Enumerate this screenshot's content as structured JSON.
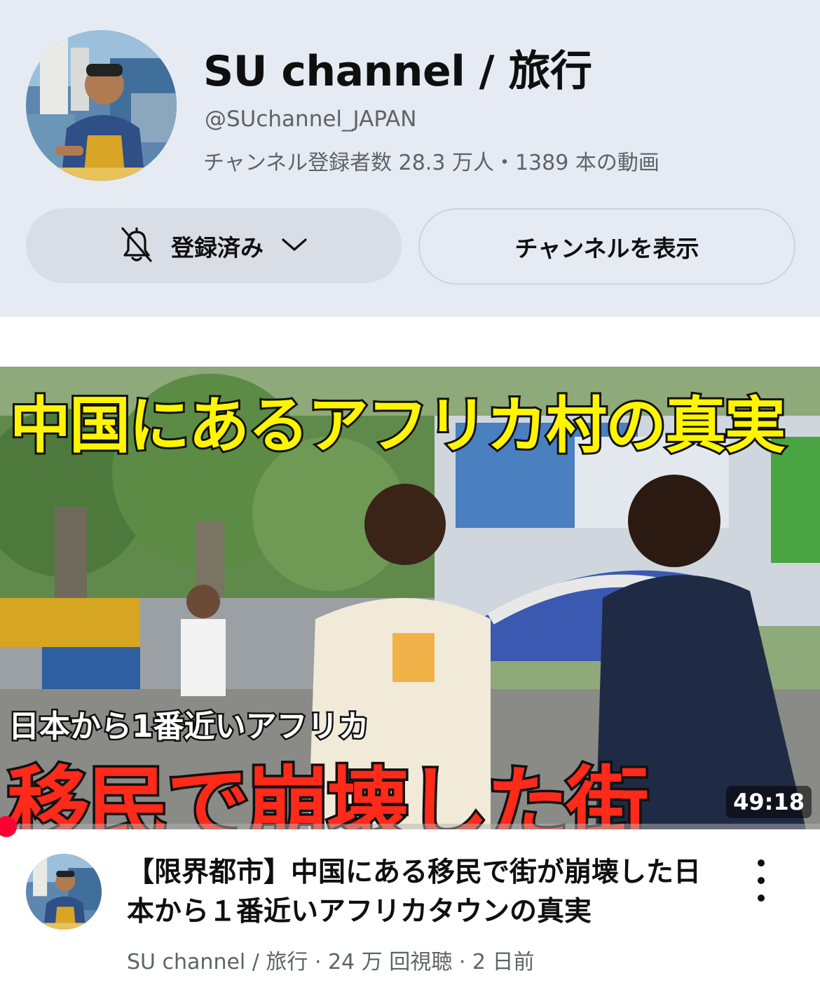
{
  "channel": {
    "title": "SU channel / 旅行",
    "handle": "@SUchannel_JAPAN",
    "stats": "チャンネル登録者数 28.3 万人・1389 本の動画",
    "subscribe_label": "登録済み",
    "view_channel_label": "チャンネルを表示"
  },
  "video": {
    "thumbnail_text": {
      "top": "中国にあるアフリカ村の真実",
      "middle": "日本から1番近いアフリカ",
      "bottom": "移民で崩壊した街"
    },
    "duration": "49:18",
    "title": "【限界都市】中国にある移民で街が崩壊した日本から１番近いアフリカタウンの真実",
    "meta": "SU channel / 旅行 · 24 万 回視聴 · 2 日前",
    "progress_fraction": 0.01
  },
  "colors": {
    "header_bg": "#e6ebf3",
    "accent_red": "#ff0033",
    "thumb_yellow": "#fff500",
    "thumb_red": "#ff2a1a"
  },
  "icons": [
    "bell-off-icon",
    "chevron-down-icon",
    "more-vert-icon"
  ]
}
